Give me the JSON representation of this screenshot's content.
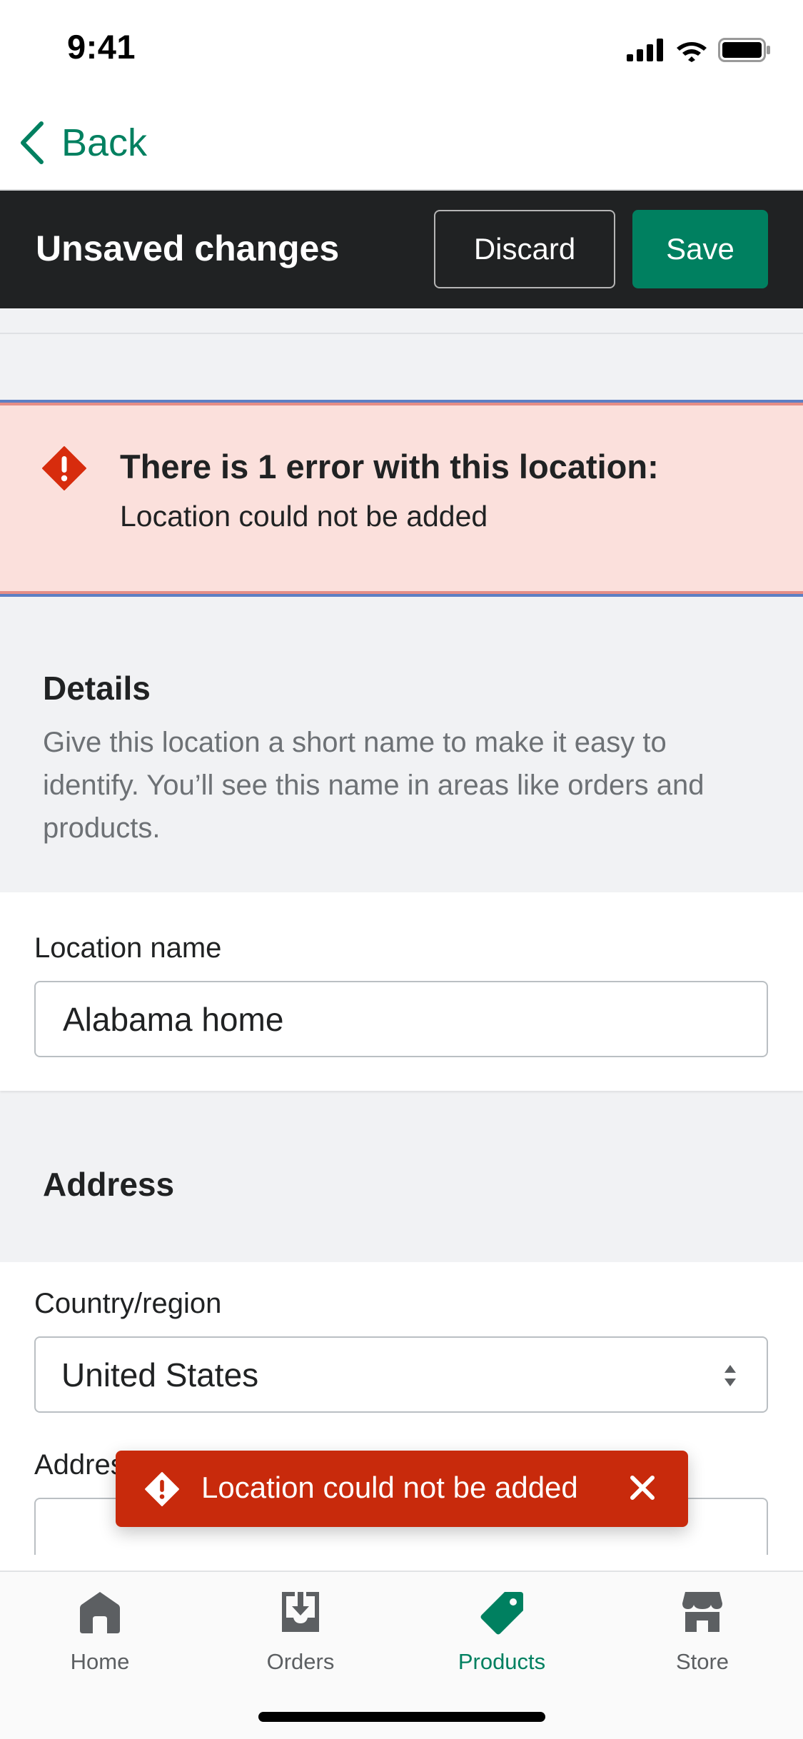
{
  "status_bar": {
    "time": "9:41"
  },
  "nav": {
    "back_label": "Back"
  },
  "unsaved_bar": {
    "title": "Unsaved changes",
    "discard_label": "Discard",
    "save_label": "Save"
  },
  "error_banner": {
    "title": "There is 1 error with this location:",
    "message": "Location could not be added"
  },
  "details": {
    "title": "Details",
    "description": "Give this location a short name to make it easy to identify. You’ll see this name in areas like orders and products."
  },
  "location_name": {
    "label": "Location name",
    "value": "Alabama home"
  },
  "address": {
    "title": "Address",
    "country_label": "Country/region",
    "country_value": "United States",
    "address_label": "Address"
  },
  "toast": {
    "message": "Location could not be added"
  },
  "tab_bar": {
    "tabs": [
      {
        "label": "Home",
        "icon": "home-icon"
      },
      {
        "label": "Orders",
        "icon": "orders-icon"
      },
      {
        "label": "Products",
        "icon": "tag-icon",
        "active": true
      },
      {
        "label": "Store",
        "icon": "store-icon"
      }
    ]
  },
  "colors": {
    "accent": "#008060",
    "critical": "#c82a0c",
    "error_banner_bg": "#fbe0dc",
    "dark_bar": "#202223",
    "page_bg": "#f1f2f4"
  }
}
